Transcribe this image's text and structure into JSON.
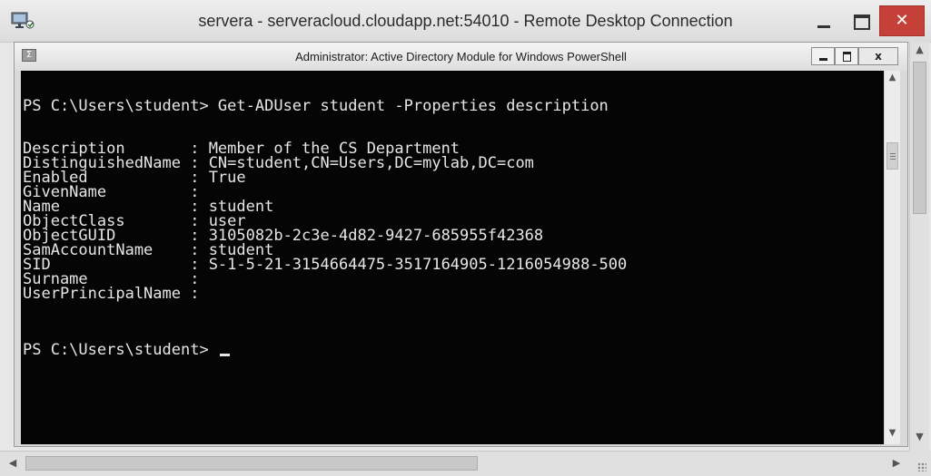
{
  "rdp_window": {
    "title": "servera - serveracloud.cloudapp.net:54010 - Remote Desktop Connection",
    "app_icon": "remote-desktop-icon",
    "close_glyph": "✕"
  },
  "ps_window": {
    "title": "Administrator: Active Directory Module for Windows PowerShell",
    "icon": "powershell-icon",
    "icon_glyph": "Σ",
    "close_glyph": "x"
  },
  "console": {
    "command_line": "PS C:\\Users\\student> Get-ADUser student -Properties description",
    "properties": [
      {
        "line": "Description       : Member of the CS Department"
      },
      {
        "line": "DistinguishedName : CN=student,CN=Users,DC=mylab,DC=com"
      },
      {
        "line": "Enabled           : True"
      },
      {
        "line": "GivenName         :"
      },
      {
        "line": "Name              : student"
      },
      {
        "line": "ObjectClass       : user"
      },
      {
        "line": "ObjectGUID        : 3105082b-2c3e-4d82-9427-685955f42368"
      },
      {
        "line": "SamAccountName    : student"
      },
      {
        "line": "SID               : S-1-5-21-3154664475-3517164905-1216054988-500"
      },
      {
        "line": "Surname           :"
      },
      {
        "line": "UserPrincipalName :"
      }
    ],
    "prompt": "PS C:\\Users\\student> "
  },
  "scrollbars": {
    "up_arrow": "▲",
    "down_arrow": "▼",
    "left_arrow": "◀",
    "right_arrow": "▶"
  }
}
